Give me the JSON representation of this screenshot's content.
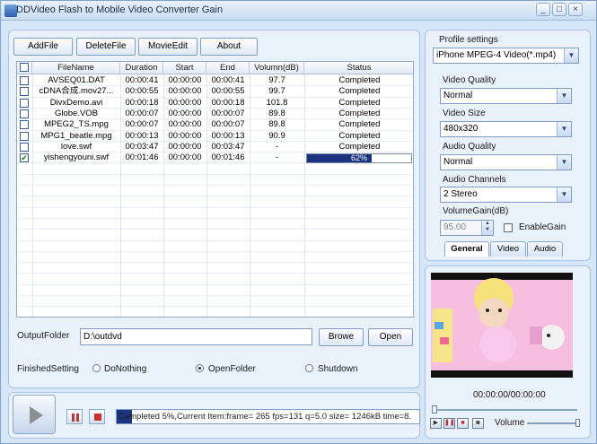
{
  "window": {
    "title": "DDVideo Flash to Mobile Video Converter Gain",
    "controls": [
      "_",
      "□",
      "×"
    ]
  },
  "toolbar": {
    "add_file": "AddFile",
    "delete_file": "DeleteFile",
    "movie_edit": "MovieEdit",
    "about": "About"
  },
  "file_list": {
    "columns": [
      "FileName",
      "Duration",
      "Start",
      "End",
      "Volumn(dB)",
      "Status"
    ],
    "rows": [
      {
        "checked": false,
        "file_name": "AVSEQ01.DAT",
        "duration": "00:00:41",
        "start": "00:00:00",
        "end": "00:00:41",
        "volume": "97.7",
        "status": "Completed"
      },
      {
        "checked": false,
        "file_name": "cDNA合成.mov27...",
        "duration": "00:00:55",
        "start": "00:00:00",
        "end": "00:00:55",
        "volume": "99.7",
        "status": "Completed"
      },
      {
        "checked": false,
        "file_name": "DivxDemo.avi",
        "duration": "00:00:18",
        "start": "00:00:00",
        "end": "00:00:18",
        "volume": "101.8",
        "status": "Completed"
      },
      {
        "checked": false,
        "file_name": "Globe.VOB",
        "duration": "00:00:07",
        "start": "00:00:00",
        "end": "00:00:07",
        "volume": "89.8",
        "status": "Completed"
      },
      {
        "checked": false,
        "file_name": "MPEG2_TS.mpg",
        "duration": "00:00:07",
        "start": "00:00:00",
        "end": "00:00:07",
        "volume": "89.8",
        "status": "Completed"
      },
      {
        "checked": false,
        "file_name": "MPG1_beatle.mpg",
        "duration": "00:00:13",
        "start": "00:00:00",
        "end": "00:00:13",
        "volume": "90.9",
        "status": "Completed"
      },
      {
        "checked": false,
        "file_name": "love.swf",
        "duration": "00:03:47",
        "start": "00:00:00",
        "end": "00:03:47",
        "volume": "-",
        "status": "Completed"
      },
      {
        "checked": true,
        "file_name": "yishengyouni.swf",
        "duration": "00:01:46",
        "start": "00:00:00",
        "end": "00:01:46",
        "volume": "-",
        "status": "62%",
        "progress": 0.62
      }
    ]
  },
  "output": {
    "label": "OutputFolder",
    "value": "D:\\outdvd",
    "browse": "Browe",
    "open": "Open"
  },
  "finished": {
    "label": "FinishedSetting",
    "options": [
      "DoNothing",
      "OpenFolder",
      "Shutdown"
    ],
    "selected": "OpenFolder"
  },
  "profile": {
    "label": "Profile settings",
    "value": "iPhone MPEG-4 Video(*.mp4)"
  },
  "settings": {
    "video_quality_label": "Video Quality",
    "video_quality": "Normal",
    "video_size_label": "Video Size",
    "video_size": "480x320",
    "audio_quality_label": "Audio Quality",
    "audio_quality": "Normal",
    "audio_channels_label": "Audio Channels",
    "audio_channels": "2  Stereo",
    "volume_gain_label": "VolumeGain(dB)",
    "volume_gain": "95.00",
    "enable_gain": "EnableGain",
    "tabs": [
      "General",
      "Video",
      "Audio"
    ]
  },
  "player": {
    "time": "00:00:00/00:00:00",
    "volume_label": "Volume"
  },
  "status": {
    "text": "Completed 5%,Current Item:frame=  265 fps=131 q=5.0 size=    1246kB time=8.",
    "progress": 0.05
  },
  "colors": {
    "accent": "#1a3482",
    "window_bg": "#d6e6f7"
  }
}
